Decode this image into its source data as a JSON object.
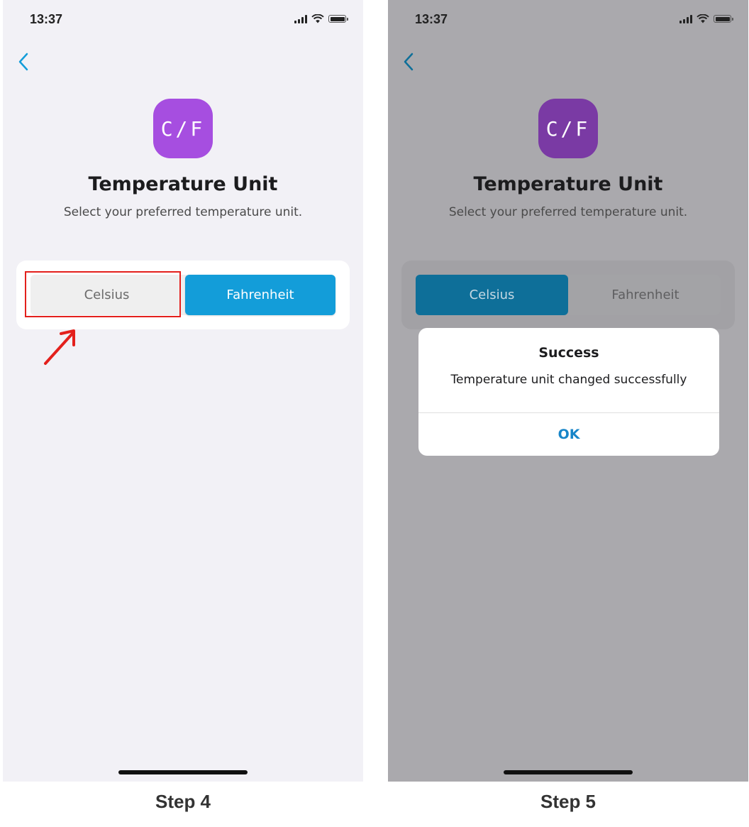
{
  "colors": {
    "accent": "#139dd9",
    "accent_dimmed": "#0e6f99",
    "icon_purple": "#a64ee0",
    "highlight_red": "#e3201c",
    "alert_button": "#1785c8"
  },
  "step4": {
    "status_time": "13:37",
    "back_icon": "chevron-left-icon",
    "app_icon_text": "C/F",
    "title": "Temperature Unit",
    "subtitle": "Select your preferred temperature unit.",
    "options": [
      "Celsius",
      "Fahrenheit"
    ],
    "selected": "Fahrenheit",
    "highlighted": "Celsius",
    "caption": "Step 4"
  },
  "step5": {
    "status_time": "13:37",
    "back_icon": "chevron-left-icon",
    "app_icon_text": "C/F",
    "title": "Temperature Unit",
    "subtitle": "Select your preferred temperature unit.",
    "options": [
      "Celsius",
      "Fahrenheit"
    ],
    "selected": "Celsius",
    "alert": {
      "title": "Success",
      "message": "Temperature unit changed successfully",
      "button": "OK"
    },
    "caption": "Step 5"
  }
}
